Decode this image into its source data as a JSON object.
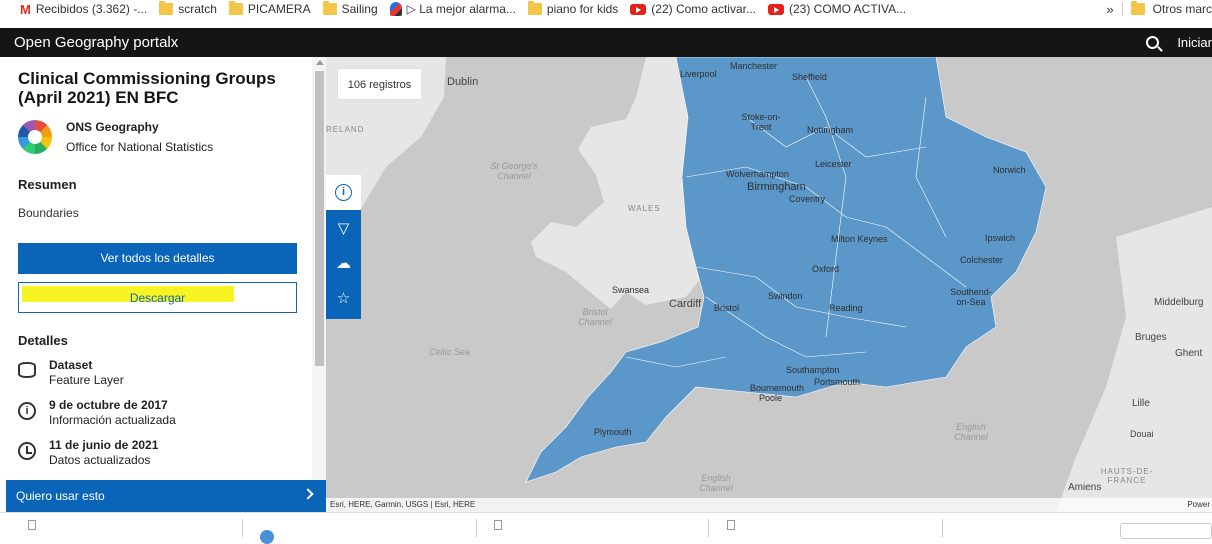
{
  "bookmarks": [
    {
      "label": "Recibidos (3.362) -...",
      "icon": "gmail-icon"
    },
    {
      "label": "scratch",
      "icon": "folder-icon"
    },
    {
      "label": "PICAMERA",
      "icon": "folder-icon"
    },
    {
      "label": "Sailing",
      "icon": "folder-icon"
    },
    {
      "label": "▷ La mejor alarma...",
      "icon": "app-icon"
    },
    {
      "label": "piano for kids",
      "icon": "folder-icon"
    },
    {
      "label": "(22) Como activar...",
      "icon": "youtube-icon"
    },
    {
      "label": "(23) COMO ACTIVA...",
      "icon": "youtube-icon"
    }
  ],
  "bookmarks_overflow": "»",
  "other_bookmarks": "Otros marc",
  "portal": {
    "title": "Open Geography portalx",
    "signin": "Iniciar"
  },
  "item": {
    "title": "Clinical Commissioning Groups (April 2021) EN BFC",
    "owner_name": "ONS Geography",
    "owner_org": "Office for National Statistics",
    "summary_heading": "Resumen",
    "summary_text": "Boundaries",
    "btn_details": "Ver todos los detalles",
    "btn_download": "Descargar",
    "details_heading": "Detalles",
    "details": [
      {
        "title": "Dataset",
        "sub": "Feature Layer",
        "icon": "database-icon"
      },
      {
        "title": "9 de octubre de 2017",
        "sub": "Información actualizada",
        "icon": "info-icon"
      },
      {
        "title": "11 de junio de 2021",
        "sub": "Datos actualizados",
        "icon": "history-icon"
      }
    ],
    "use_banner": "Quiero usar esto"
  },
  "map": {
    "record_count": "106 registros",
    "tools": [
      "info-icon",
      "filter-icon",
      "download-cloud-icon",
      "star-icon"
    ],
    "labels": {
      "dublin": "Dublin",
      "ireland": "RELAND",
      "wales": "WALES",
      "st_georges": "St George's Channel",
      "bristol_ch": "Bristol Channel",
      "celtic": "Celtic Sea",
      "english_ch": "English Channel",
      "english_ch2": "English Channel",
      "swansea": "Swansea",
      "cardiff": "Cardiff",
      "bristol": "Bristol",
      "swindon": "Swindon",
      "reading": "Reading",
      "oxford": "Oxford",
      "milton": "Milton Keynes",
      "coventry": "Coventry",
      "birmingham": "Birmingham",
      "wolverhampton": "Wolverhampton",
      "leicester": "Leicester",
      "nottingham": "Nottingham",
      "stoke": "Stoke-on-Trent",
      "liverpool": "Liverpool",
      "manchester": "Manchester",
      "sheffield": "Sheffield",
      "norwich": "Norwich",
      "ipswich": "Ipswich",
      "colchester": "Colchester",
      "southend": "Southend-on-Sea",
      "southampton": "Southampton",
      "portsmouth": "Portsmouth",
      "bournemouth": "Bournemouth",
      "poole": "Poole",
      "plymouth": "Plymouth",
      "middelburg": "Middelburg",
      "bruges": "Bruges",
      "ghent": "Ghent",
      "lille": "Lille",
      "douai": "Douai",
      "hauts": "HAUTS-DE-FRANCE",
      "amiens": "Amiens"
    },
    "attribution": "Esri, HERE, Garmin, USGS | Esri, HERE",
    "powered": "Power",
    "region_fill": "#5b97c9",
    "land_fill": "#e6e6e6",
    "sea_fill": "#c9c9c9"
  }
}
